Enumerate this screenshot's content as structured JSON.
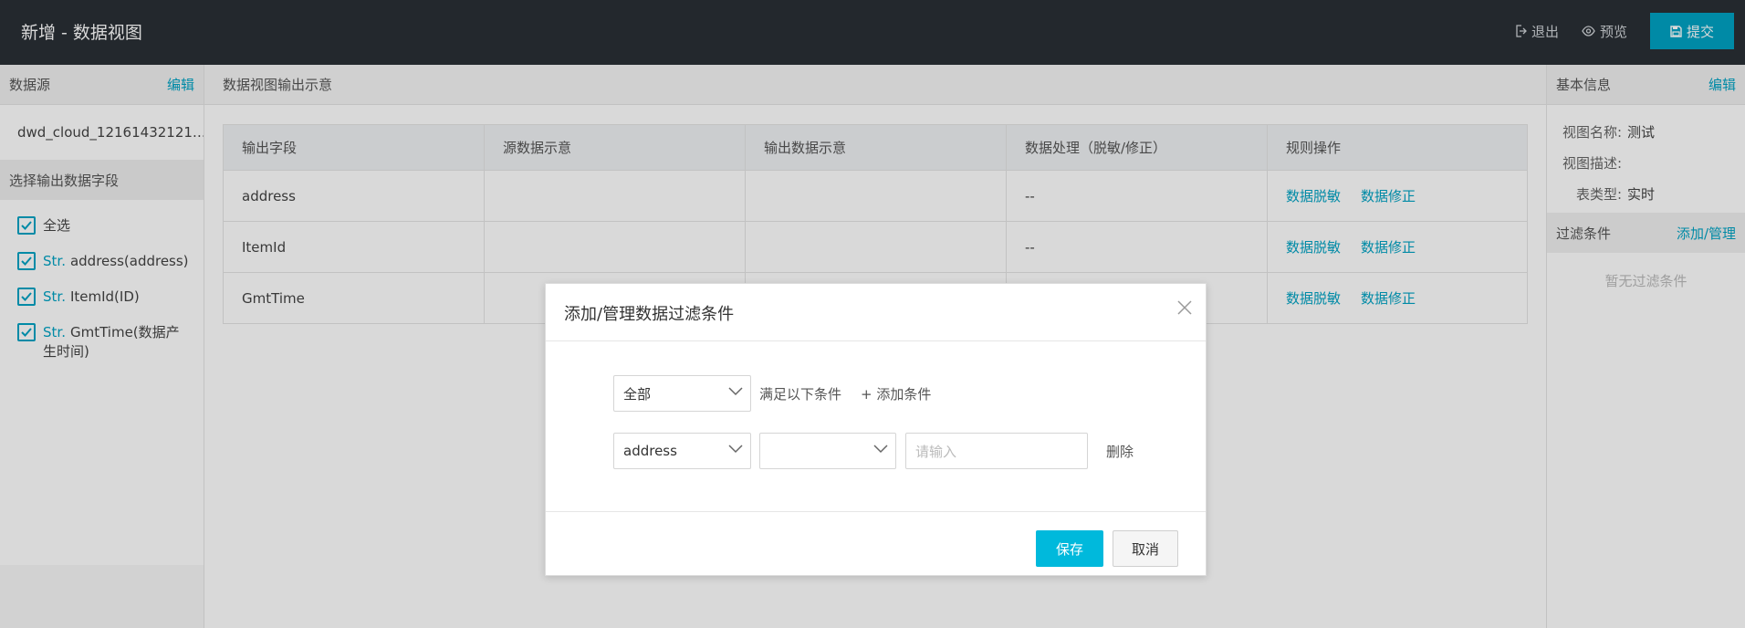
{
  "header": {
    "title": "新增 - 数据视图",
    "exit_label": "退出",
    "preview_label": "预览",
    "submit_label": "提交"
  },
  "left_panel": {
    "datasource_title": "数据源",
    "edit_label": "编辑",
    "datasource_name": "dwd_cloud_12161432121…",
    "fields_title": "选择输出数据字段",
    "select_all_label": "全选",
    "fields": [
      {
        "type": "Str.",
        "label": "address(address)"
      },
      {
        "type": "Str.",
        "label": "ItemId(ID)"
      },
      {
        "type": "Str.",
        "label": "GmtTime(数据产生时间)"
      }
    ]
  },
  "center_panel": {
    "title": "数据视图输出示意",
    "columns": [
      "输出字段",
      "源数据示意",
      "输出数据示意",
      "数据处理（脱敏/修正）",
      "规则操作"
    ],
    "rows": [
      {
        "field": "address",
        "source": "",
        "output": "",
        "processing": "--",
        "op1": "数据脱敏",
        "op2": "数据修正"
      },
      {
        "field": "ItemId",
        "source": "",
        "output": "",
        "processing": "--",
        "op1": "数据脱敏",
        "op2": "数据修正"
      },
      {
        "field": "GmtTime",
        "source": "",
        "output": "",
        "processing": "",
        "op1": "数据脱敏",
        "op2": "数据修正"
      }
    ]
  },
  "right_panel": {
    "title": "基本信息",
    "edit_label": "编辑",
    "name_key": "视图名称:",
    "name_value": "测试",
    "desc_key": "视图描述:",
    "desc_value": "",
    "type_key": "表类型:",
    "type_value": "实时",
    "filter_title": "过滤条件",
    "filter_action": "添加/管理",
    "filter_empty": "暂无过滤条件"
  },
  "modal": {
    "title": "添加/管理数据过滤条件",
    "match_select": "全部",
    "match_text": "满足以下条件",
    "add_condition": "+ 添加条件",
    "field_select": "address",
    "operator_select": "",
    "value_placeholder": "请输入",
    "delete_label": "删除",
    "save_label": "保存",
    "cancel_label": "取消"
  },
  "colors": {
    "accent": "#00a3c4",
    "primary_button": "#00b9dc",
    "topbar": "#2a2f35"
  }
}
